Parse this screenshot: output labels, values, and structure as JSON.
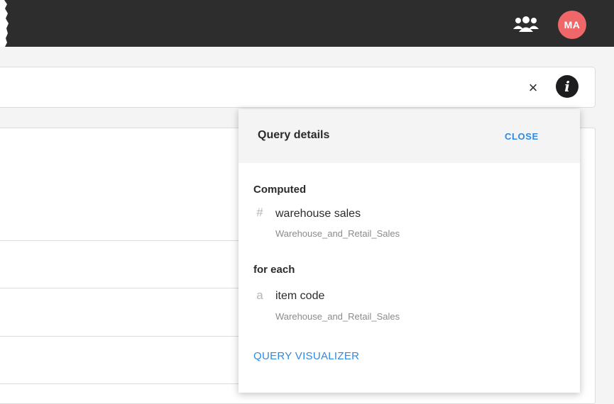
{
  "header": {
    "users_icon": "users-group-icon",
    "avatar_initials": "MA",
    "avatar_color": "#f0676a",
    "bar_color": "#2d2d2e"
  },
  "search": {
    "clear_icon": "close-icon",
    "clear_glyph": "×",
    "info_icon": "info-icon",
    "info_glyph": "i"
  },
  "query_panel": {
    "title": "Query details",
    "close_label": "CLOSE",
    "sections": [
      {
        "title": "Computed",
        "columns": [
          {
            "type_icon": "#",
            "name": "warehouse sales",
            "source": "Warehouse_and_Retail_Sales"
          }
        ]
      },
      {
        "title": "for each",
        "columns": [
          {
            "type_icon": "a",
            "name": "item code",
            "source": "Warehouse_and_Retail_Sales"
          }
        ]
      }
    ],
    "visualizer_label": "QUERY VISUALIZER",
    "accent_color": "#2f8ae0"
  }
}
